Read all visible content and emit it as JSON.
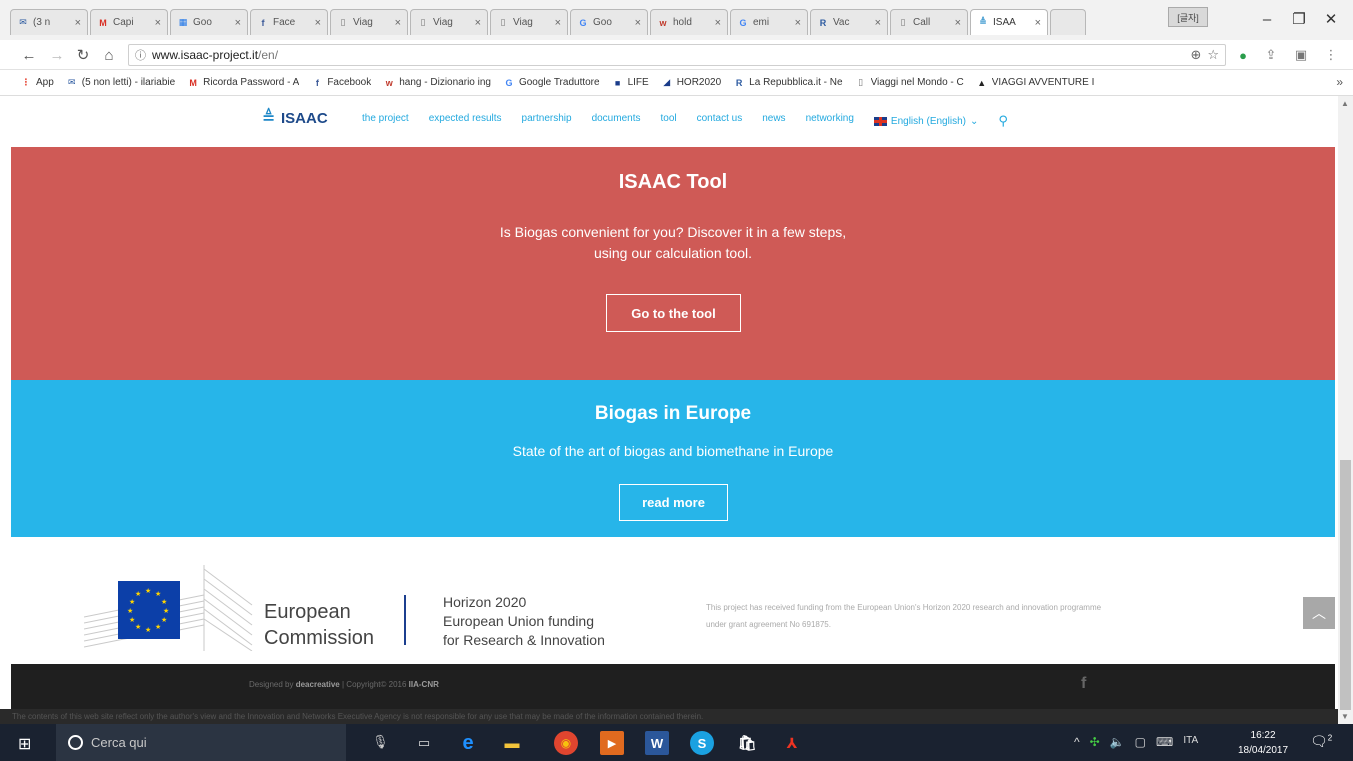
{
  "browser": {
    "tabs": [
      {
        "label": "(3 n",
        "icon": "mail",
        "color": "#2c5aa0"
      },
      {
        "label": "Capi",
        "icon": "gmail",
        "color": "#d93025"
      },
      {
        "label": "Goo",
        "icon": "calendar",
        "color": "#1a73e8"
      },
      {
        "label": "Face",
        "icon": "facebook",
        "color": "#3b5998"
      },
      {
        "label": "Viag",
        "icon": "page",
        "color": "#777777"
      },
      {
        "label": "Viag",
        "icon": "page",
        "color": "#777777"
      },
      {
        "label": "Viag",
        "icon": "page",
        "color": "#777777"
      },
      {
        "label": "Goo",
        "icon": "translate",
        "color": "#4285f4"
      },
      {
        "label": "hold",
        "icon": "wordreference",
        "color": "#c0392b"
      },
      {
        "label": "emi",
        "icon": "google",
        "color": "#4285f4"
      },
      {
        "label": "Vac",
        "icon": "repubblica",
        "color": "#2c5aa0"
      },
      {
        "label": "Call",
        "icon": "page",
        "color": "#777777"
      },
      {
        "label": "ISAA",
        "icon": "isaac",
        "color": "#1e88c8"
      }
    ],
    "profile_label": "[글자]",
    "url_host": "www.isaac-project.it",
    "url_path": "/en/",
    "bookmarks": [
      {
        "label": "App",
        "icon": "apps",
        "color": "#e74c3c"
      },
      {
        "label": "(5 non letti) - ilariabie",
        "icon": "mail",
        "color": "#2c5aa0"
      },
      {
        "label": "Ricorda Password - A",
        "icon": "gmail",
        "color": "#d93025"
      },
      {
        "label": "Facebook",
        "icon": "facebook",
        "color": "#3b5998"
      },
      {
        "label": "hang - Dizionario ing",
        "icon": "wordreference",
        "color": "#c0392b"
      },
      {
        "label": "Google Traduttore",
        "icon": "translate",
        "color": "#4285f4"
      },
      {
        "label": "LIFE",
        "icon": "life",
        "color": "#1a3c8a"
      },
      {
        "label": "HOR2020",
        "icon": "hor2020",
        "color": "#1a3c8a"
      },
      {
        "label": "La Repubblica.it - Ne",
        "icon": "repubblica",
        "color": "#2c5aa0"
      },
      {
        "label": "Viaggi nel Mondo - C",
        "icon": "page",
        "color": "#777777"
      },
      {
        "label": "VIAGGI AVVENTURE I",
        "icon": "viaggi",
        "color": "#222222"
      }
    ]
  },
  "site": {
    "logo": "ISAAC",
    "nav": [
      "the project",
      "expected results",
      "partnership",
      "documents",
      "tool",
      "contact us",
      "news",
      "networking"
    ],
    "language": "English (English)"
  },
  "tool_section": {
    "title": "ISAAC Tool",
    "line1": "Is Biogas convenient for you? Discover it in a few steps,",
    "line2": "using our calculation tool.",
    "button": "Go to the tool",
    "bg": "#cf5a56"
  },
  "biogas_section": {
    "title": "Biogas in Europe",
    "description": "State of the art of biogas and biomethane in Europe",
    "button": "read more",
    "bg": "#27b5e9"
  },
  "funding": {
    "ec_line1": "European",
    "ec_line2": "Commission",
    "h2020_line1": "Horizon 2020",
    "h2020_line2": "European Union funding",
    "h2020_line3": "for Research & Innovation",
    "grant_line1": "This project has received funding from the European Union's Horizon 2020 research and innovation programme",
    "grant_line2": "under grant agreement No 691875."
  },
  "footer": {
    "designed_by": "Designed by",
    "designer": "deacreative",
    "copyright": "| Copyright© 2016",
    "owner": "IIA-CNR",
    "disclaimer": "The contents of this web site reflect only the author's view and the Innovation and Networks Executive Agency is not responsible for any use that may be made of the information contained therein."
  },
  "taskbar": {
    "search_placeholder": "Cerca qui",
    "language": "ITA",
    "time": "16:22",
    "date": "18/04/2017",
    "notifications": "2"
  }
}
